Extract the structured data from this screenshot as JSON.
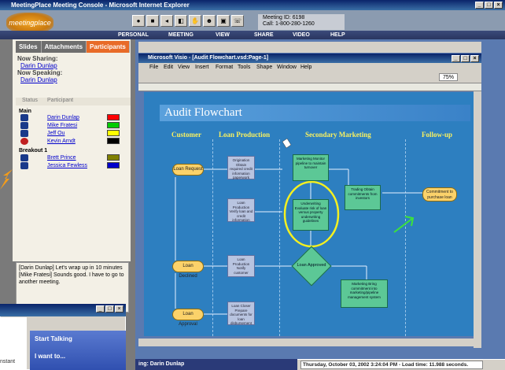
{
  "browser": {
    "title": "MeetingPlace Meeting Console - Microsoft Internet Explorer",
    "controls": [
      "_",
      "□",
      "×"
    ]
  },
  "header": {
    "logo": "meetingplace",
    "meeting_id": "Meeting ID: 6198",
    "call": "Call: 1-800-280-1260",
    "menu": [
      "PERSONAL",
      "MEETING",
      "VIEW",
      "SHARE",
      "VIDEO",
      "HELP"
    ]
  },
  "left": {
    "tabs": [
      "Slides",
      "Attachments",
      "Participants"
    ],
    "now_sharing_label": "Now Sharing:",
    "now_sharing": "Darin Dunlap",
    "now_speaking_label": "Now Speaking:",
    "now_speaking": "Darin Dunlap",
    "columns": [
      "Status",
      "Participant"
    ],
    "groups": [
      {
        "name": "Main",
        "people": [
          {
            "name": "Darin Dunlap",
            "color": "#ff0000"
          },
          {
            "name": "Mike Fratesi",
            "color": "#00cc00"
          },
          {
            "name": "Jeff Ou",
            "color": "#ffff00"
          },
          {
            "name": "Kevin Arndt",
            "color": "#000000"
          }
        ]
      },
      {
        "name": "Breakout 1",
        "people": [
          {
            "name": "Brett Prince",
            "color": "#808000"
          },
          {
            "name": "Jessica Fewless",
            "color": "#0000cc"
          }
        ]
      }
    ],
    "chat": [
      "[Darin Dunlap] Let's wrap up in 10 minutes",
      "[Mike Fratesi] Sounds good. I have to go to another meeting."
    ]
  },
  "talk": {
    "start": "Start Talking",
    "want": "I want to...",
    "instant": "nstant",
    "controls": [
      "_",
      "□",
      "×"
    ]
  },
  "visio": {
    "title": "Microsoft Visio - [Audit Flowchart.vsd:Page-1]",
    "menu": [
      "File",
      "Edit",
      "View",
      "Insert",
      "Format",
      "Tools",
      "Shape",
      "Window",
      "Help"
    ],
    "zoom": "75%",
    "controls": [
      "_",
      "□",
      "×"
    ]
  },
  "flowchart": {
    "title": "Audit Flowchart",
    "columns": [
      "Customer",
      "Loan Production",
      "Secondary Marketing",
      "Follow-up"
    ],
    "ovals": [
      "Loan Request",
      "Loan Declined",
      "Loan Approval",
      "Commitment to purchase loan"
    ],
    "process_a": [
      "Origination Obtain required credit information paperwork",
      "Loan Production Verify loan and credit information",
      "Loan Production Notify customer",
      "Loan Closer Prepare documents for loan disbursement"
    ],
    "process_b": [
      "Marketing Monitor pipeline to maintain turnover",
      "Underwriting Evaluate risk of loan versus property underwriting guidelines",
      "Trading Obtain commitments from investors",
      "Marketing Bring commitment into marketing/pipeline management system"
    ],
    "decision": "Loan Approved"
  },
  "status": {
    "left": "ing: Darin Dunlap",
    "right": "Thursday, October 03, 2002 3:24:04 PM - Load time: 11.988 seconds."
  }
}
